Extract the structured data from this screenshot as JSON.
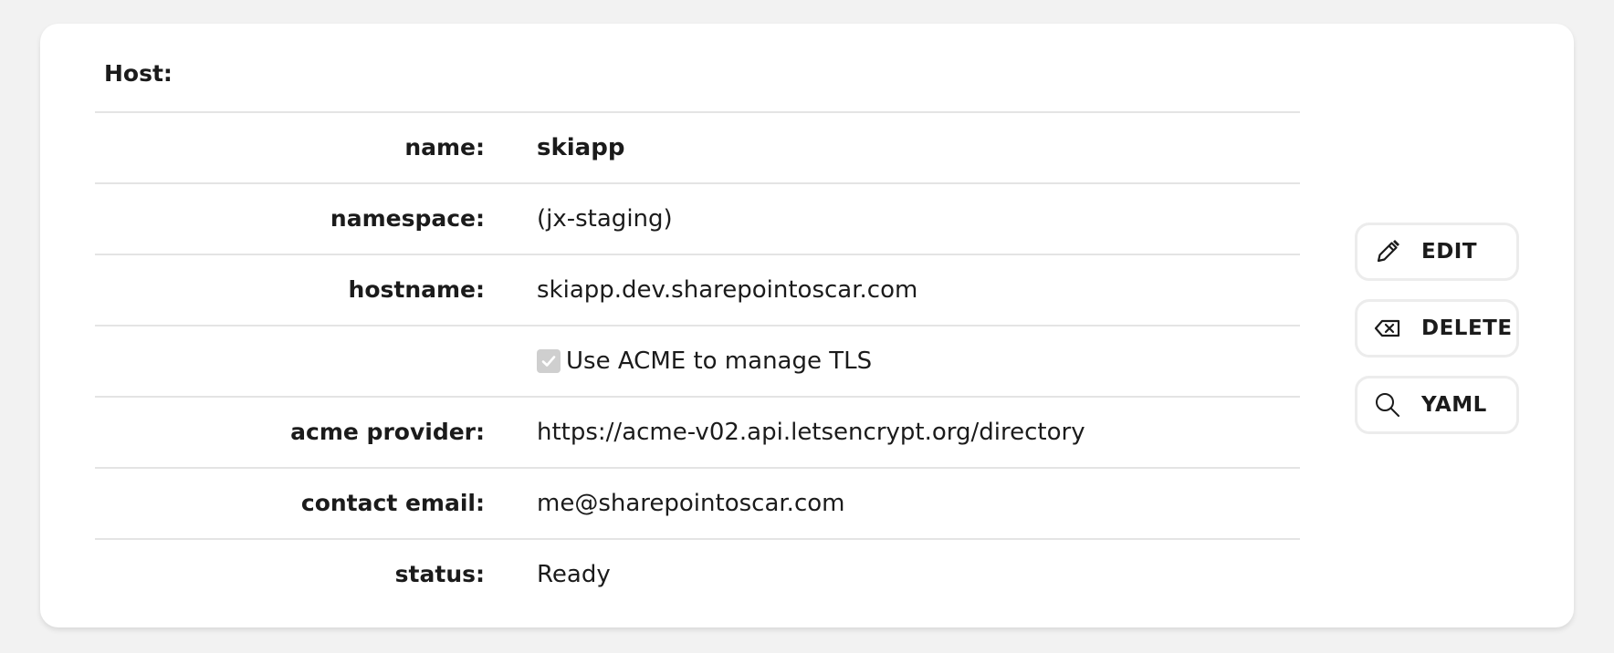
{
  "host": {
    "title": "Host:",
    "rows": [
      {
        "label": "name:",
        "value": "skiapp"
      },
      {
        "label": "namespace:",
        "value": "(jx-staging)"
      },
      {
        "label": "hostname:",
        "value": "skiapp.dev.sharepointoscar.com"
      },
      {
        "label": "",
        "checkbox_label": "Use ACME to manage TLS",
        "checked": true
      },
      {
        "label": "acme provider:",
        "value": "https://acme-v02.api.letsencrypt.org/directory"
      },
      {
        "label": "contact email:",
        "value": "me@sharepointoscar.com"
      },
      {
        "label": "status:",
        "value": "Ready"
      }
    ]
  },
  "actions": {
    "edit": {
      "label": "EDIT",
      "icon": "pencil-icon"
    },
    "delete": {
      "label": "DELETE",
      "icon": "backspace-icon"
    },
    "yaml": {
      "label": "YAML",
      "icon": "search-icon"
    }
  },
  "colors": {
    "page_background": "#f2f2f2",
    "card_background": "#ffffff",
    "divider": "#e4e4e4",
    "checkbox_disabled": "#cfcfcf"
  }
}
